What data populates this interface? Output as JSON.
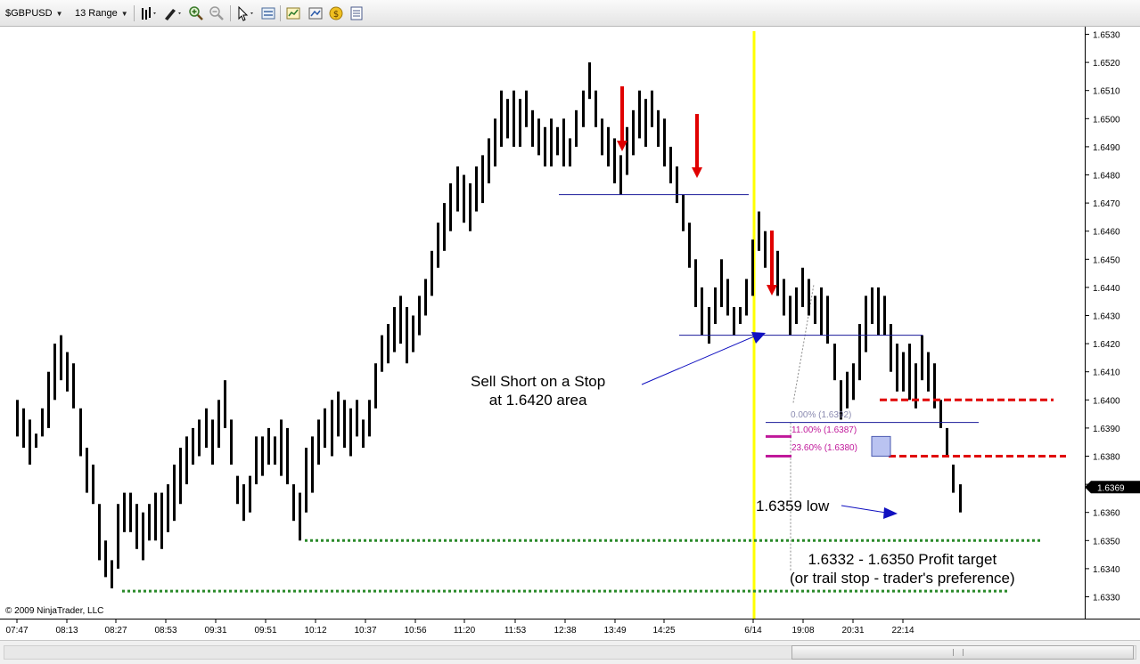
{
  "toolbar": {
    "instrument": "$GBPUSD",
    "bar_type": "13 Range",
    "icons": [
      "bar-style-icon",
      "draw-pen-icon",
      "zoom-in-icon",
      "zoom-out-icon",
      "pointer-icon",
      "data-box-icon",
      "chart-wizard-icon",
      "properties-icon",
      "strategy-icon",
      "notes-icon"
    ]
  },
  "chart": {
    "copyright": "© 2009 NinjaTrader, LLC",
    "time_labels": [
      "07:47",
      "08:13",
      "08:27",
      "08:53",
      "09:31",
      "09:51",
      "10:12",
      "10:37",
      "10:56",
      "11:20",
      "11:53",
      "12:38",
      "13:49",
      "14:25",
      "6/14",
      "19:08",
      "20:31",
      "22:14"
    ],
    "price_labels": [
      "1.6530",
      "1.6520",
      "1.6510",
      "1.6500",
      "1.6490",
      "1.6480",
      "1.6470",
      "1.6460",
      "1.6450",
      "1.6440",
      "1.6430",
      "1.6420",
      "1.6410",
      "1.6400",
      "1.6390",
      "1.6380",
      "1.6370",
      "1.6360",
      "1.6350",
      "1.6340",
      "1.6330"
    ],
    "last_price": "1.6369",
    "colors": {
      "bars": "#000000",
      "session_line": "#ffff00",
      "arrows": "#e00000",
      "support_lines": "#1a1a9a",
      "targets": "#2a8a2a",
      "stops": "#e00000",
      "fib": "#c0189a"
    }
  },
  "annotations": {
    "sell_short": "Sell Short on a Stop\nat 1.6420 area",
    "low": "1.6359 low",
    "profit_target": "1.6332 - 1.6350 Profit target\n(or trail stop  - trader's preference)"
  },
  "fib_levels": [
    {
      "label": "0.00% (1.6392)",
      "price": 1.6392
    },
    {
      "label": "11.00% (1.6387)",
      "price": 1.6387
    },
    {
      "label": "23.60% (1.6380)",
      "price": 1.638
    }
  ],
  "chart_data": {
    "type": "bar",
    "instrument": "$GBPUSD",
    "interval": "13 Range",
    "ylim": [
      1.6325,
      1.6533
    ],
    "bars": [
      [
        1.64,
        1.6387
      ],
      [
        1.6397,
        1.6383
      ],
      [
        1.6393,
        1.6377
      ],
      [
        1.6388,
        1.6383
      ],
      [
        1.6397,
        1.6387
      ],
      [
        1.641,
        1.639
      ],
      [
        1.642,
        1.64
      ],
      [
        1.6423,
        1.6407
      ],
      [
        1.6417,
        1.6403
      ],
      [
        1.6413,
        1.6397
      ],
      [
        1.6397,
        1.638
      ],
      [
        1.6383,
        1.6367
      ],
      [
        1.6377,
        1.6363
      ],
      [
        1.6363,
        1.6343
      ],
      [
        1.635,
        1.6337
      ],
      [
        1.6343,
        1.6333
      ],
      [
        1.6363,
        1.634
      ],
      [
        1.6367,
        1.6353
      ],
      [
        1.6367,
        1.6353
      ],
      [
        1.6363,
        1.6347
      ],
      [
        1.636,
        1.6343
      ],
      [
        1.6363,
        1.635
      ],
      [
        1.6367,
        1.635
      ],
      [
        1.6367,
        1.6347
      ],
      [
        1.637,
        1.6353
      ],
      [
        1.6377,
        1.6357
      ],
      [
        1.6383,
        1.6363
      ],
      [
        1.6387,
        1.637
      ],
      [
        1.639,
        1.6377
      ],
      [
        1.6393,
        1.638
      ],
      [
        1.6397,
        1.6383
      ],
      [
        1.6393,
        1.6377
      ],
      [
        1.64,
        1.6383
      ],
      [
        1.6407,
        1.639
      ],
      [
        1.6393,
        1.6377
      ],
      [
        1.6373,
        1.6363
      ],
      [
        1.637,
        1.6357
      ],
      [
        1.6373,
        1.636
      ],
      [
        1.6387,
        1.637
      ],
      [
        1.6387,
        1.6373
      ],
      [
        1.639,
        1.6377
      ],
      [
        1.6387,
        1.6377
      ],
      [
        1.6393,
        1.6373
      ],
      [
        1.639,
        1.637
      ],
      [
        1.637,
        1.6357
      ],
      [
        1.6367,
        1.635
      ],
      [
        1.6383,
        1.636
      ],
      [
        1.6387,
        1.6367
      ],
      [
        1.6393,
        1.6377
      ],
      [
        1.6397,
        1.6383
      ],
      [
        1.64,
        1.638
      ],
      [
        1.6403,
        1.6387
      ],
      [
        1.64,
        1.6383
      ],
      [
        1.6397,
        1.638
      ],
      [
        1.64,
        1.6387
      ],
      [
        1.6393,
        1.6383
      ],
      [
        1.64,
        1.6387
      ],
      [
        1.6413,
        1.6397
      ],
      [
        1.6423,
        1.641
      ],
      [
        1.6427,
        1.6413
      ],
      [
        1.6433,
        1.6417
      ],
      [
        1.6437,
        1.642
      ],
      [
        1.6433,
        1.6413
      ],
      [
        1.643,
        1.6417
      ],
      [
        1.6437,
        1.6423
      ],
      [
        1.6443,
        1.643
      ],
      [
        1.6453,
        1.6437
      ],
      [
        1.6463,
        1.6447
      ],
      [
        1.647,
        1.6453
      ],
      [
        1.6477,
        1.646
      ],
      [
        1.6483,
        1.6467
      ],
      [
        1.648,
        1.6463
      ],
      [
        1.6477,
        1.646
      ],
      [
        1.6483,
        1.6467
      ],
      [
        1.6487,
        1.647
      ],
      [
        1.6493,
        1.6477
      ],
      [
        1.65,
        1.6483
      ],
      [
        1.651,
        1.649
      ],
      [
        1.6507,
        1.6493
      ],
      [
        1.651,
        1.649
      ],
      [
        1.6507,
        1.649
      ],
      [
        1.651,
        1.6497
      ],
      [
        1.6503,
        1.649
      ],
      [
        1.65,
        1.6487
      ],
      [
        1.6497,
        1.6483
      ],
      [
        1.65,
        1.6483
      ],
      [
        1.6497,
        1.6487
      ],
      [
        1.65,
        1.6483
      ],
      [
        1.6493,
        1.6483
      ],
      [
        1.6503,
        1.649
      ],
      [
        1.651,
        1.6497
      ],
      [
        1.652,
        1.6507
      ],
      [
        1.651,
        1.6497
      ],
      [
        1.65,
        1.6487
      ],
      [
        1.6497,
        1.6483
      ],
      [
        1.6493,
        1.6477
      ],
      [
        1.6487,
        1.6473
      ],
      [
        1.6497,
        1.648
      ],
      [
        1.6503,
        1.6487
      ],
      [
        1.651,
        1.6493
      ],
      [
        1.6507,
        1.649
      ],
      [
        1.651,
        1.6497
      ],
      [
        1.6503,
        1.649
      ],
      [
        1.65,
        1.6483
      ],
      [
        1.649,
        1.6477
      ],
      [
        1.6483,
        1.647
      ],
      [
        1.6473,
        1.646
      ],
      [
        1.6463,
        1.6447
      ],
      [
        1.645,
        1.6433
      ],
      [
        1.644,
        1.6423
      ],
      [
        1.6433,
        1.642
      ],
      [
        1.644,
        1.6427
      ],
      [
        1.645,
        1.6433
      ],
      [
        1.6443,
        1.643
      ],
      [
        1.6433,
        1.6423
      ],
      [
        1.6433,
        1.6427
      ],
      [
        1.6443,
        1.643
      ],
      [
        1.6457,
        1.6437
      ],
      [
        1.6467,
        1.6453
      ],
      [
        1.646,
        1.6447
      ],
      [
        1.646,
        1.6443
      ],
      [
        1.6453,
        1.6437
      ],
      [
        1.6443,
        1.643
      ],
      [
        1.6437,
        1.6423
      ],
      [
        1.644,
        1.6427
      ],
      [
        1.6447,
        1.6433
      ],
      [
        1.6443,
        1.643
      ],
      [
        1.6437,
        1.6427
      ],
      [
        1.644,
        1.6423
      ],
      [
        1.6437,
        1.642
      ],
      [
        1.642,
        1.6407
      ],
      [
        1.6407,
        1.6393
      ],
      [
        1.641,
        1.6397
      ],
      [
        1.6413,
        1.64
      ],
      [
        1.6427,
        1.6407
      ],
      [
        1.6437,
        1.6417
      ],
      [
        1.644,
        1.6427
      ],
      [
        1.644,
        1.6423
      ],
      [
        1.6437,
        1.6423
      ],
      [
        1.6427,
        1.641
      ],
      [
        1.642,
        1.6403
      ],
      [
        1.6417,
        1.6403
      ],
      [
        1.642,
        1.64
      ],
      [
        1.6413,
        1.6397
      ],
      [
        1.6423,
        1.6407
      ],
      [
        1.6417,
        1.6403
      ],
      [
        1.6413,
        1.6397
      ],
      [
        1.64,
        1.639
      ],
      [
        1.639,
        1.638
      ],
      [
        1.6377,
        1.6367
      ],
      [
        1.637,
        1.636
      ]
    ],
    "x_ticks": [
      "07:47",
      "08:13",
      "08:27",
      "08:53",
      "09:31",
      "09:51",
      "10:12",
      "10:37",
      "10:56",
      "11:20",
      "11:53",
      "12:38",
      "13:49",
      "14:25",
      "6/14",
      "19:08",
      "20:31",
      "22:14"
    ],
    "y_ticks": [
      "1.6530",
      "1.6520",
      "1.6510",
      "1.6500",
      "1.6490",
      "1.6480",
      "1.6470",
      "1.6460",
      "1.6450",
      "1.6440",
      "1.6430",
      "1.6420",
      "1.6410",
      "1.6400",
      "1.6390",
      "1.6380",
      "1.6370",
      "1.6360",
      "1.6350",
      "1.6340",
      "1.6330"
    ],
    "last_price": 1.6369,
    "horizontal_lines": [
      {
        "kind": "resistance",
        "price": 1.6473
      },
      {
        "kind": "entry",
        "price": 1.6423
      },
      {
        "kind": "fib-base",
        "price": 1.6392
      },
      {
        "kind": "stop",
        "price": 1.64
      },
      {
        "kind": "stop",
        "price": 1.638
      },
      {
        "kind": "target",
        "price": 1.635
      },
      {
        "kind": "target",
        "price": 1.6332
      }
    ],
    "signal_arrows": [
      1.6487,
      1.6477,
      1.6433
    ],
    "grid": false
  }
}
